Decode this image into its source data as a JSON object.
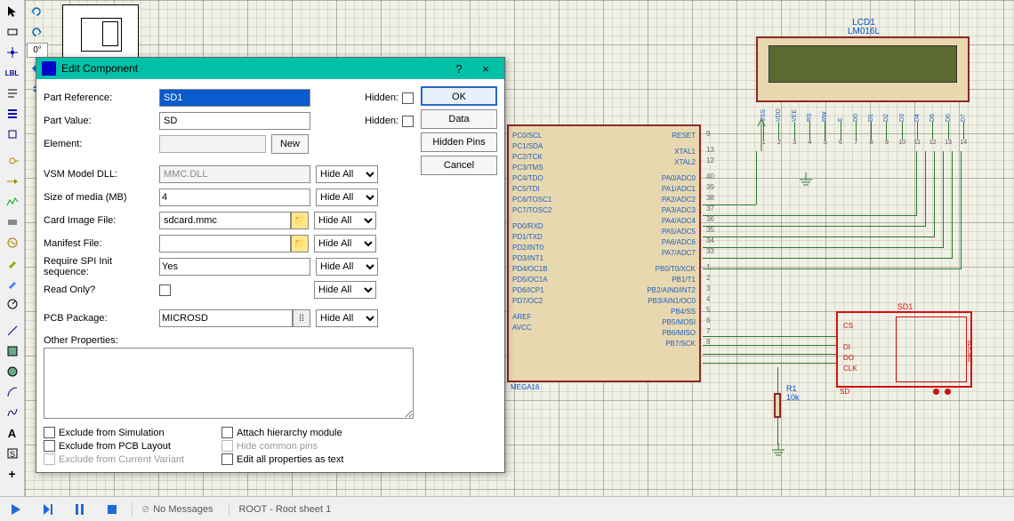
{
  "dialog": {
    "title": "Edit Component",
    "help": "?",
    "close": "×",
    "fields": {
      "part_reference_label": "Part Reference:",
      "part_reference_value": "SD1",
      "part_value_label": "Part Value:",
      "part_value_value": "SD",
      "element_label": "Element:",
      "element_value": "",
      "new_btn": "New",
      "hidden_label": "Hidden:",
      "vsm_model_label": "VSM Model DLL:",
      "vsm_model_value": "MMC.DLL",
      "size_label": "Size of media (MB)",
      "size_value": "4",
      "card_image_label": "Card Image File:",
      "card_image_value": "sdcard.mmc",
      "manifest_label": "Manifest File:",
      "manifest_value": "",
      "spi_label": "Require SPI Init sequence:",
      "spi_value": "Yes",
      "readonly_label": "Read Only?",
      "pcb_label": "PCB Package:",
      "pcb_value": "MICROSD",
      "other_props_label": "Other Properties:",
      "hide_all": "Hide All"
    },
    "checks": {
      "exclude_sim": "Exclude from Simulation",
      "exclude_pcb": "Exclude from PCB Layout",
      "exclude_variant": "Exclude from Current Variant",
      "attach_hierarchy": "Attach hierarchy module",
      "hide_common": "Hide common pins",
      "edit_all": "Edit all properties as text"
    },
    "buttons": {
      "ok": "OK",
      "data": "Data",
      "hidden_pins": "Hidden Pins",
      "cancel": "Cancel"
    }
  },
  "bottom": {
    "no_messages": "No Messages",
    "sheet": "ROOT - Root sheet 1"
  },
  "schematic": {
    "lcd": {
      "ref": "LCD1",
      "type": "LM016L",
      "pins": [
        "VSS",
        "VDD",
        "VEE",
        "RS",
        "RW",
        "E",
        "D0",
        "D1",
        "D2",
        "D3",
        "D4",
        "D5",
        "D6",
        "D7"
      ],
      "pin_nums": [
        "1",
        "2",
        "3",
        "4",
        "5",
        "6",
        "7",
        "8",
        "9",
        "10",
        "11",
        "12",
        "13",
        "14"
      ]
    },
    "mcu": {
      "type": "MEGA16",
      "left_pins": [
        "PC0/SCL",
        "PC1/SDA",
        "PC2/TCK",
        "PC3/TMS",
        "PC4/TDO",
        "PC5/TDI",
        "PC6/TOSC1",
        "PC7/TOSC2",
        "",
        "PD0/RXD",
        "PD1/TXD",
        "PD2/INT0",
        "PD3/INT1",
        "PD4/OC1B",
        "PD5/OC1A",
        "PD6/ICP1",
        "PD7/OC2",
        "",
        "AREF",
        "AVCC"
      ],
      "right_pins": [
        "RESET",
        "",
        "XTAL1",
        "XTAL2",
        "",
        "PA0/ADC0",
        "PA1/ADC1",
        "PA2/ADC2",
        "PA3/ADC3",
        "PA4/ADC4",
        "PA5/ADC5",
        "PA6/ADC6",
        "PA7/ADC7",
        "",
        "PB0/T0/XCK",
        "PB1/T1",
        "PB2/AIN0/INT2",
        "PB3/AIN1/OC0",
        "PB4/SS",
        "PB5/MOSI",
        "PB6/MISO",
        "PB7/SCK"
      ],
      "right_nums": [
        "9",
        "",
        "13",
        "12",
        "",
        "40",
        "39",
        "38",
        "37",
        "36",
        "35",
        "34",
        "33",
        "",
        "1",
        "2",
        "3",
        "4",
        "5",
        "6",
        "7",
        "8"
      ]
    },
    "sd": {
      "ref": "SD1",
      "type": "SD",
      "pins": [
        "CS",
        "DI",
        "DO",
        "CLK"
      ]
    },
    "resistor": {
      "ref": "R1",
      "value": "10k"
    }
  },
  "toolbar_zero": "0°"
}
